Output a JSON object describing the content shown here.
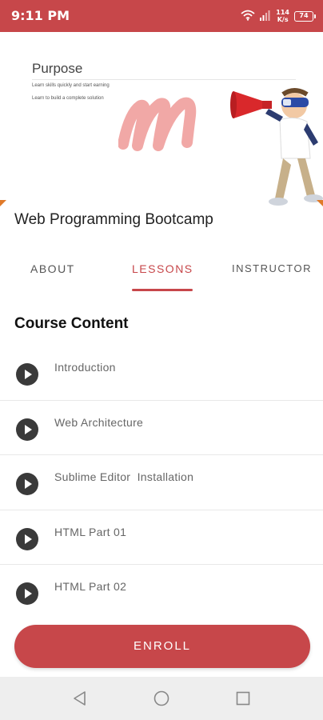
{
  "status_bar": {
    "time": "9:11 PM",
    "speed_value": "114",
    "speed_unit": "K/s",
    "battery": "74"
  },
  "banner": {
    "heading": "Purpose",
    "line1": "Learn skills quickly and start earning",
    "line2": "Learn to build a complete solution"
  },
  "course": {
    "title": "Web Programming Bootcamp"
  },
  "tabs": [
    {
      "label": "ABOUT",
      "active": false
    },
    {
      "label": "LESSONS",
      "active": true
    },
    {
      "label": "INSTRUCTOR",
      "active": false
    }
  ],
  "content": {
    "heading": "Course Content",
    "lessons": [
      {
        "label": "Introduction"
      },
      {
        "label": "Web Architecture"
      },
      {
        "label": "Sublime Editor  Installation"
      },
      {
        "label": "HTML Part 01"
      },
      {
        "label": "HTML Part 02"
      }
    ]
  },
  "enroll": {
    "label": "ENROLL"
  },
  "colors": {
    "primary": "#c7474a",
    "accent_orange": "#e07a2a"
  },
  "icons": {
    "wifi": "wifi-icon",
    "signal": "signal-icon",
    "battery": "battery-icon",
    "play": "play-icon",
    "back": "back-triangle-icon",
    "home": "home-circle-icon",
    "recent": "recent-square-icon"
  }
}
